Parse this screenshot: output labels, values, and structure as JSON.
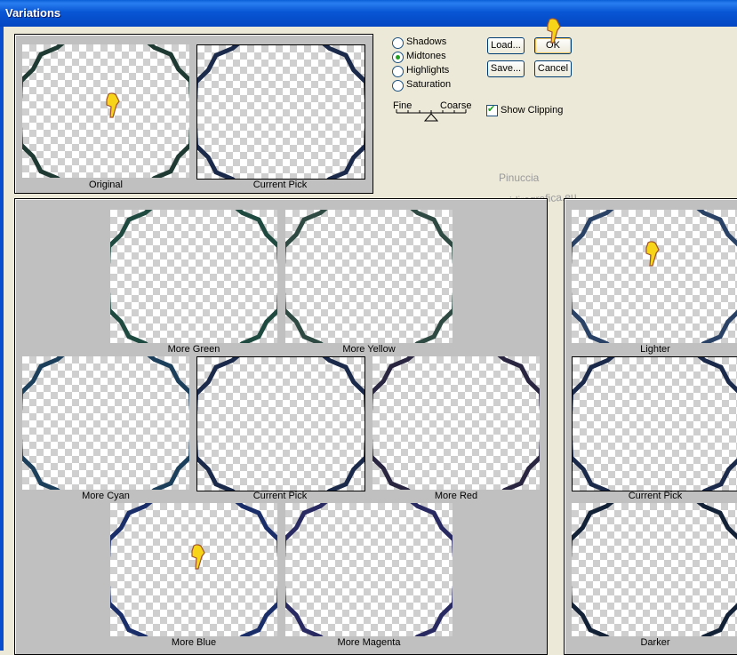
{
  "window": {
    "title": "Variations"
  },
  "tones": [
    {
      "label": "Shadows",
      "selected": false
    },
    {
      "label": "Midtones",
      "selected": true
    },
    {
      "label": "Highlights",
      "selected": false
    },
    {
      "label": "Saturation",
      "selected": false
    }
  ],
  "slider": {
    "fine_label": "Fine",
    "coarse_label": "Coarse"
  },
  "buttons": {
    "load": "Load...",
    "ok": "OK",
    "save": "Save...",
    "cancel": "Cancel"
  },
  "show_clipping": {
    "label": "Show Clipping",
    "checked": true
  },
  "watermark": {
    "line1": "Pinuccia",
    "line2": "www.maidiregrafica.eu"
  },
  "preview": {
    "original": "Original",
    "current": "Current Pick"
  },
  "color_grid": {
    "more_green": "More Green",
    "more_yellow": "More Yellow",
    "more_cyan": "More Cyan",
    "current": "Current Pick",
    "more_red": "More Red",
    "more_blue": "More Blue",
    "more_magenta": "More Magenta"
  },
  "brightness": {
    "lighter": "Lighter",
    "current": "Current Pick",
    "darker": "Darker"
  },
  "frame_colors": {
    "original": "#1e3a32",
    "current": "#1b2a4a",
    "green": "#1e4a40",
    "yellow": "#2e4a42",
    "cyan": "#1c3f5c",
    "red": "#2a2540",
    "blue": "#1a2e6a",
    "magenta": "#2a2a62",
    "lighter": "#2a4266",
    "darker": "#142238"
  },
  "colors": {
    "titlebar": "#0a5fd8",
    "dialog_bg": "#ece9d8",
    "panel_bg": "#c0c0c0"
  }
}
